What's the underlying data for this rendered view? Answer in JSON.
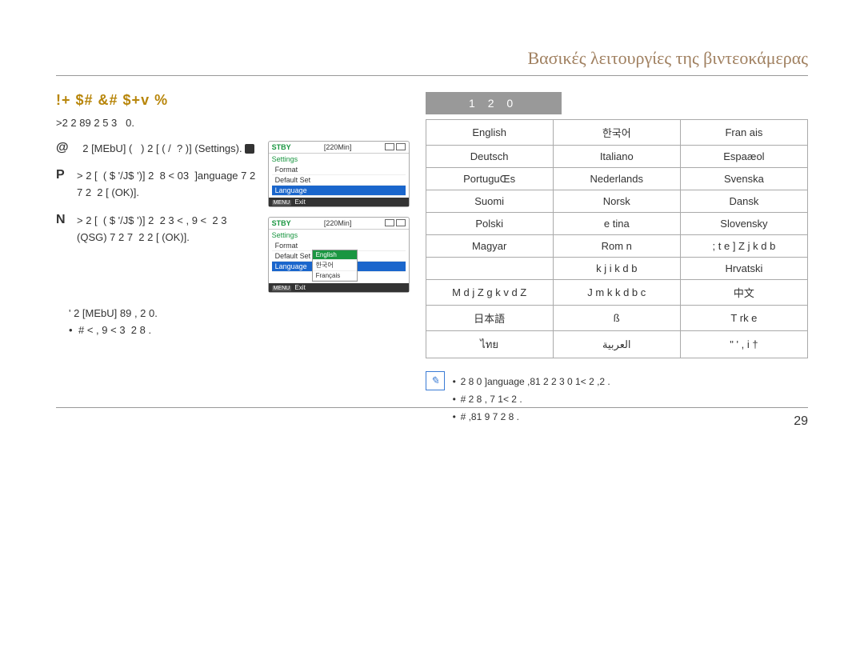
{
  "chapter_title": "Βασικές λειτουργίες της βιντεοκάμερας",
  "section_title": "!+ $# &#  $+v  %",
  "intro": ">2        2  89            2        5      3   0.",
  "steps": [
    {
      "num": "@",
      "text": "  2 [MEbU]   (   )  2 [      (   /  ?  )]  (Settings)."
    },
    {
      "num": "P",
      "text": ">        2 [   ( $ '/J$ ')]   2       8 <   03  ]anguage   7   2 7 2    2 [    (OK)]."
    },
    {
      "num": "N",
      "text": ">        2 [   ( $ '/J$ ')]   2    2 3       < , 9 <    2    3  (QSG)   7   2 7    2      2 [    (OK)]."
    }
  ],
  "after_steps": [
    {
      "text": "'         2 [MEbU]   89 ,  2       0."
    },
    {
      "text": "#    <  , 9 <  3    2    8     .",
      "isBullet": true
    }
  ],
  "screens": {
    "stby": "STBY",
    "time": "[220Min]",
    "settings_label": "Settings",
    "items": [
      "Format",
      "Default Set",
      "Language"
    ],
    "sub_items": [
      "English",
      "한국어",
      "Français"
    ],
    "exit": "Exit",
    "menu_label": "MENU"
  },
  "options_heading": "1   2   0",
  "languages": [
    [
      "English",
      "한국어",
      "Fran ais"
    ],
    [
      "Deutsch",
      "Italiano",
      "Espaæol"
    ],
    [
      "PortuguŒs",
      "Nederlands",
      "Svenska"
    ],
    [
      "Suomi",
      "Norsk",
      "Dansk"
    ],
    [
      "Polski",
      "e tina",
      "Slovensky"
    ],
    [
      "Magyar",
      "Rom n",
      "; t e ] Z j k d b"
    ],
    [
      "",
      "k j i k d b",
      "Hrvatski"
    ],
    [
      "M d j Z   g k v d Z",
      "J m k k d b c",
      "中文"
    ],
    [
      "日本語",
      "ß",
      "T rk e"
    ],
    [
      "ไทย",
      "العربية",
      "\" ' , i †"
    ]
  ],
  "notes": [
    "2   8        0 ]anguage  ,81       2 2  3 0  1<    2   ,2 .",
    "# 2   8       ,     7     1<     2    .",
    "#                    ,81        9 7     2   8   ."
  ],
  "page_num": "29"
}
